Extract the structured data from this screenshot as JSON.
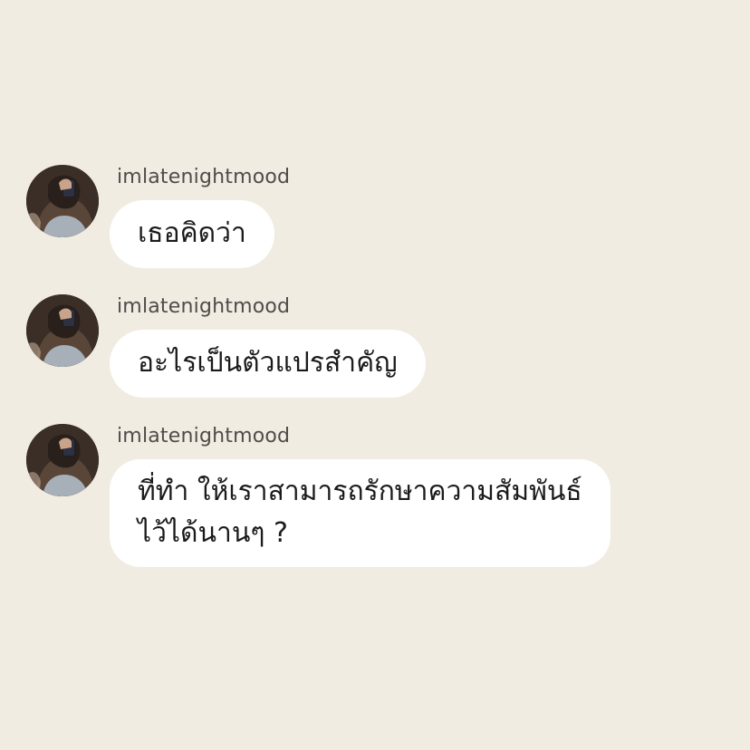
{
  "messages": [
    {
      "username": "imlatenightmood",
      "avatar_icon": "user-avatar-photo",
      "lines": [
        "เธอคิดว่า"
      ]
    },
    {
      "username": "imlatenightmood",
      "avatar_icon": "user-avatar-photo",
      "lines": [
        "อะไรเป็นตัวแปรสำคัญ"
      ]
    },
    {
      "username": "imlatenightmood",
      "avatar_icon": "user-avatar-photo",
      "lines": [
        "ที่ทำ ให้เราสามารถรักษาความสัมพันธ์",
        "ไว้ได้นานๆ ?"
      ]
    }
  ],
  "colors": {
    "background": "#f1ece2",
    "bubble": "#ffffff",
    "username": "#4f4c49",
    "text": "#1b1b1b"
  }
}
